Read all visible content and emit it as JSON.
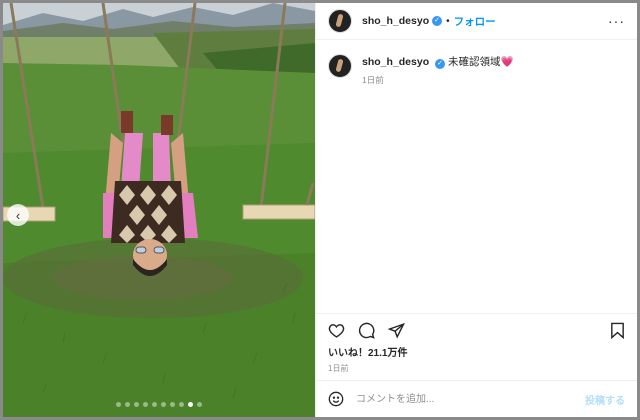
{
  "post": {
    "username": "sho_h_desyo",
    "follow_label": "フォロー",
    "separator": "•",
    "more_label": "···",
    "caption": "未確認領域💗",
    "caption_time": "1日前",
    "likes_text": "いいね！21.1万件",
    "timestamp": "1日前",
    "comment_placeholder": "コメントを追加...",
    "post_button_label": "投稿する",
    "verified_glyph": "✓",
    "carousel_prev_glyph": "‹"
  },
  "carousel": {
    "total": 10,
    "active": 9
  },
  "colors": {
    "accent": "#0095f6",
    "verified": "#3897f0",
    "post_disabled": "#b2dffc"
  },
  "icons": [
    "heart-icon",
    "comment-icon",
    "share-icon",
    "bookmark-icon",
    "emoji-icon",
    "verified-badge-icon",
    "chevron-left-icon"
  ]
}
